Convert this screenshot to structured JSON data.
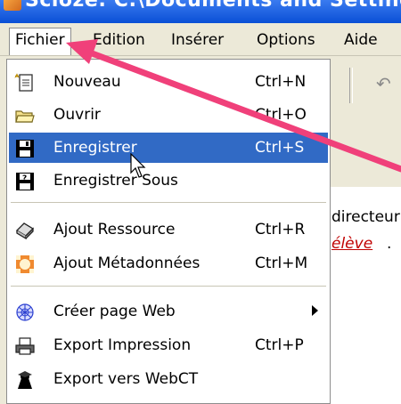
{
  "window": {
    "title": "Scloze: C:\\Documents and Settings"
  },
  "menubar": {
    "items": [
      {
        "label": "Fichier"
      },
      {
        "label": "Edition"
      },
      {
        "label": "Insérer"
      },
      {
        "label": "Options"
      },
      {
        "label": "Aide"
      }
    ]
  },
  "menu": {
    "items": [
      {
        "label": "Nouveau",
        "shortcut": "Ctrl+N",
        "icon": "new-document-icon"
      },
      {
        "label": "Ouvrir",
        "shortcut": "Ctrl+O",
        "icon": "open-folder-icon"
      },
      {
        "label": "Enregistrer",
        "shortcut": "Ctrl+S",
        "icon": "save-icon"
      },
      {
        "label": "Enregistrer Sous",
        "shortcut": "",
        "icon": "save-as-icon"
      },
      {
        "label": "Ajout Ressource",
        "shortcut": "Ctrl+R",
        "icon": "add-resource-icon"
      },
      {
        "label": "Ajout Métadonnées",
        "shortcut": "Ctrl+M",
        "icon": "add-metadata-icon"
      },
      {
        "label": "Créer page Web",
        "shortcut": "",
        "icon": "web-page-icon"
      },
      {
        "label": "Export Impression",
        "shortcut": "Ctrl+P",
        "icon": "print-icon"
      },
      {
        "label": "Export vers WebCT",
        "shortcut": "",
        "icon": "webct-icon"
      }
    ]
  },
  "document": {
    "snippet1": "directeur",
    "snippet2": "élève",
    "snippet2_end": "."
  },
  "colors": {
    "highlight": "#316ac5",
    "annotation_arrow": "#f0407a",
    "link_red": "#c00000"
  }
}
